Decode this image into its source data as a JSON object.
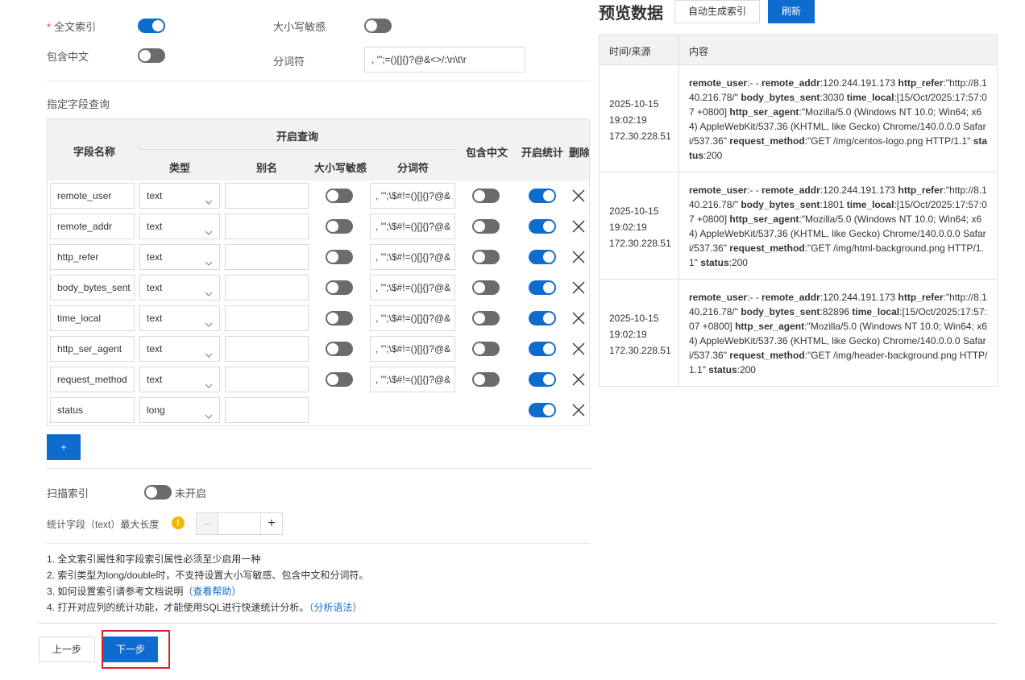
{
  "settings": {
    "fulltext_label": "全文索引",
    "fulltext_required_mark": "*",
    "fulltext_on": true,
    "case_label": "大小写敏感",
    "case_on": false,
    "chinese_label": "包含中文",
    "chinese_on": false,
    "delim_label": "分词符",
    "delim_value": ", '\";=()[]{}?@&<>/:\\n\\t\\r"
  },
  "field_query": {
    "title": "指定字段查询",
    "headers": {
      "name": "字段名称",
      "enable_query": "开启查询",
      "type": "类型",
      "alias": "别名",
      "case": "大小写敏感",
      "delim": "分词符",
      "chinese": "包含中文",
      "stats": "开启统计",
      "delete": "删除"
    },
    "rows": [
      {
        "name": "remote_user",
        "type": "text",
        "alias": "",
        "case_on": false,
        "delim": ", '\";\\$#!=()[]{}?@&",
        "chinese_on": false,
        "stats_on": true
      },
      {
        "name": "remote_addr",
        "type": "text",
        "alias": "",
        "case_on": false,
        "delim": ", '\";\\$#!=()[]{}?@&",
        "chinese_on": false,
        "stats_on": true
      },
      {
        "name": "http_refer",
        "type": "text",
        "alias": "",
        "case_on": false,
        "delim": ", '\";\\$#!=()[]{}?@&",
        "chinese_on": false,
        "stats_on": true
      },
      {
        "name": "body_bytes_sent",
        "type": "text",
        "alias": "",
        "case_on": false,
        "delim": ", '\";\\$#!=()[]{}?@&",
        "chinese_on": false,
        "stats_on": true
      },
      {
        "name": "time_local",
        "type": "text",
        "alias": "",
        "case_on": false,
        "delim": ", '\";\\$#!=()[]{}?@&",
        "chinese_on": false,
        "stats_on": true
      },
      {
        "name": "http_ser_agent",
        "type": "text",
        "alias": "",
        "case_on": false,
        "delim": ", '\";\\$#!=()[]{}?@&",
        "chinese_on": false,
        "stats_on": true
      },
      {
        "name": "request_method",
        "type": "text",
        "alias": "",
        "case_on": false,
        "delim": ", '\";\\$#!=()[]{}?@&",
        "chinese_on": false,
        "stats_on": true
      },
      {
        "name": "status",
        "type": "long",
        "alias": "",
        "stats_on": true
      }
    ],
    "add_label": "+"
  },
  "scan_index": {
    "label": "扫描索引",
    "on": false,
    "state_text": "未开启"
  },
  "stats_length": {
    "label": "统计字段（text）最大长度",
    "value": "",
    "minus": "−",
    "plus": "+"
  },
  "notes": {
    "n1": "1. 全文索引属性和字段索引属性必须至少启用一种",
    "n2": "2. 索引类型为long/double时，不支持设置大小写敏感、包含中文和分词符。",
    "n3": "3. 如何设置索引请参考文档说明",
    "n3_link": "（查看帮助）",
    "n4": "4. 打开对应列的统计功能，才能使用SQL进行快速统计分析。",
    "n4_link": "（分析语法）"
  },
  "footer": {
    "prev_label": "上一步",
    "next_label": "下一步"
  },
  "preview": {
    "title": "预览数据",
    "auto_btn": "自动生成索引",
    "refresh_btn": "刷新",
    "col_time": "时间/来源",
    "col_content": "内容",
    "rows": [
      {
        "date": "2025-10-15",
        "time": "19:02:19",
        "source": "172.30.228.51",
        "fields": [
          {
            "k": "remote_user",
            "v": ":- - "
          },
          {
            "k": "remote_addr",
            "v": ":120.244.191.173 "
          },
          {
            "k": "http_refer",
            "v": ":\"http://8.140.216.78/\" "
          },
          {
            "k": "body_bytes_sent",
            "v": ":3030 "
          },
          {
            "k": "time_local",
            "v": ":[15/Oct/2025:17:57:07 +0800] "
          },
          {
            "k": "http_ser_agent",
            "v": ":\"Mozilla/5.0 (Windows NT 10.0; Win64; x64) AppleWebKit/537.36 (KHTML, like Gecko) Chrome/140.0.0.0 Safari/537.36\" "
          },
          {
            "k": "request_method",
            "v": ":\"GET /img/centos-logo.png HTTP/1.1\" "
          },
          {
            "k": "status",
            "v": ":200"
          }
        ]
      },
      {
        "date": "2025-10-15",
        "time": "19:02:19",
        "source": "172.30.228.51",
        "fields": [
          {
            "k": "remote_user",
            "v": ":- - "
          },
          {
            "k": "remote_addr",
            "v": ":120.244.191.173 "
          },
          {
            "k": "http_refer",
            "v": ":\"http://8.140.216.78/\" "
          },
          {
            "k": "body_bytes_sent",
            "v": ":1801 "
          },
          {
            "k": "time_local",
            "v": ":[15/Oct/2025:17:57:07 +0800] "
          },
          {
            "k": "http_ser_agent",
            "v": ":\"Mozilla/5.0 (Windows NT 10.0; Win64; x64) AppleWebKit/537.36 (KHTML, like Gecko) Chrome/140.0.0.0 Safari/537.36\" "
          },
          {
            "k": "request_method",
            "v": ":\"GET /img/html-background.png HTTP/1.1\" "
          },
          {
            "k": "status",
            "v": ":200"
          }
        ]
      },
      {
        "date": "2025-10-15",
        "time": "19:02:19",
        "source": "172.30.228.51",
        "fields": [
          {
            "k": "remote_user",
            "v": ":- - "
          },
          {
            "k": "remote_addr",
            "v": ":120.244.191.173 "
          },
          {
            "k": "http_refer",
            "v": ":\"http://8.140.216.78/\" "
          },
          {
            "k": "body_bytes_sent",
            "v": ":82896 "
          },
          {
            "k": "time_local",
            "v": ":[15/Oct/2025:17:57:07 +0800] "
          },
          {
            "k": "http_ser_agent",
            "v": ":\"Mozilla/5.0 (Windows NT 10.0; Win64; x64) AppleWebKit/537.36 (KHTML, like Gecko) Chrome/140.0.0.0 Safari/537.36\" "
          },
          {
            "k": "request_method",
            "v": ":\"GET /img/header-background.png HTTP/1.1\" "
          },
          {
            "k": "status",
            "v": ":200"
          }
        ]
      }
    ]
  },
  "colors": {
    "primary": "#0f6ccf",
    "toggle_off": "#6b6b6b",
    "required": "#e64552",
    "warning": "#f5b800",
    "highlight_border": "#d9232e"
  }
}
